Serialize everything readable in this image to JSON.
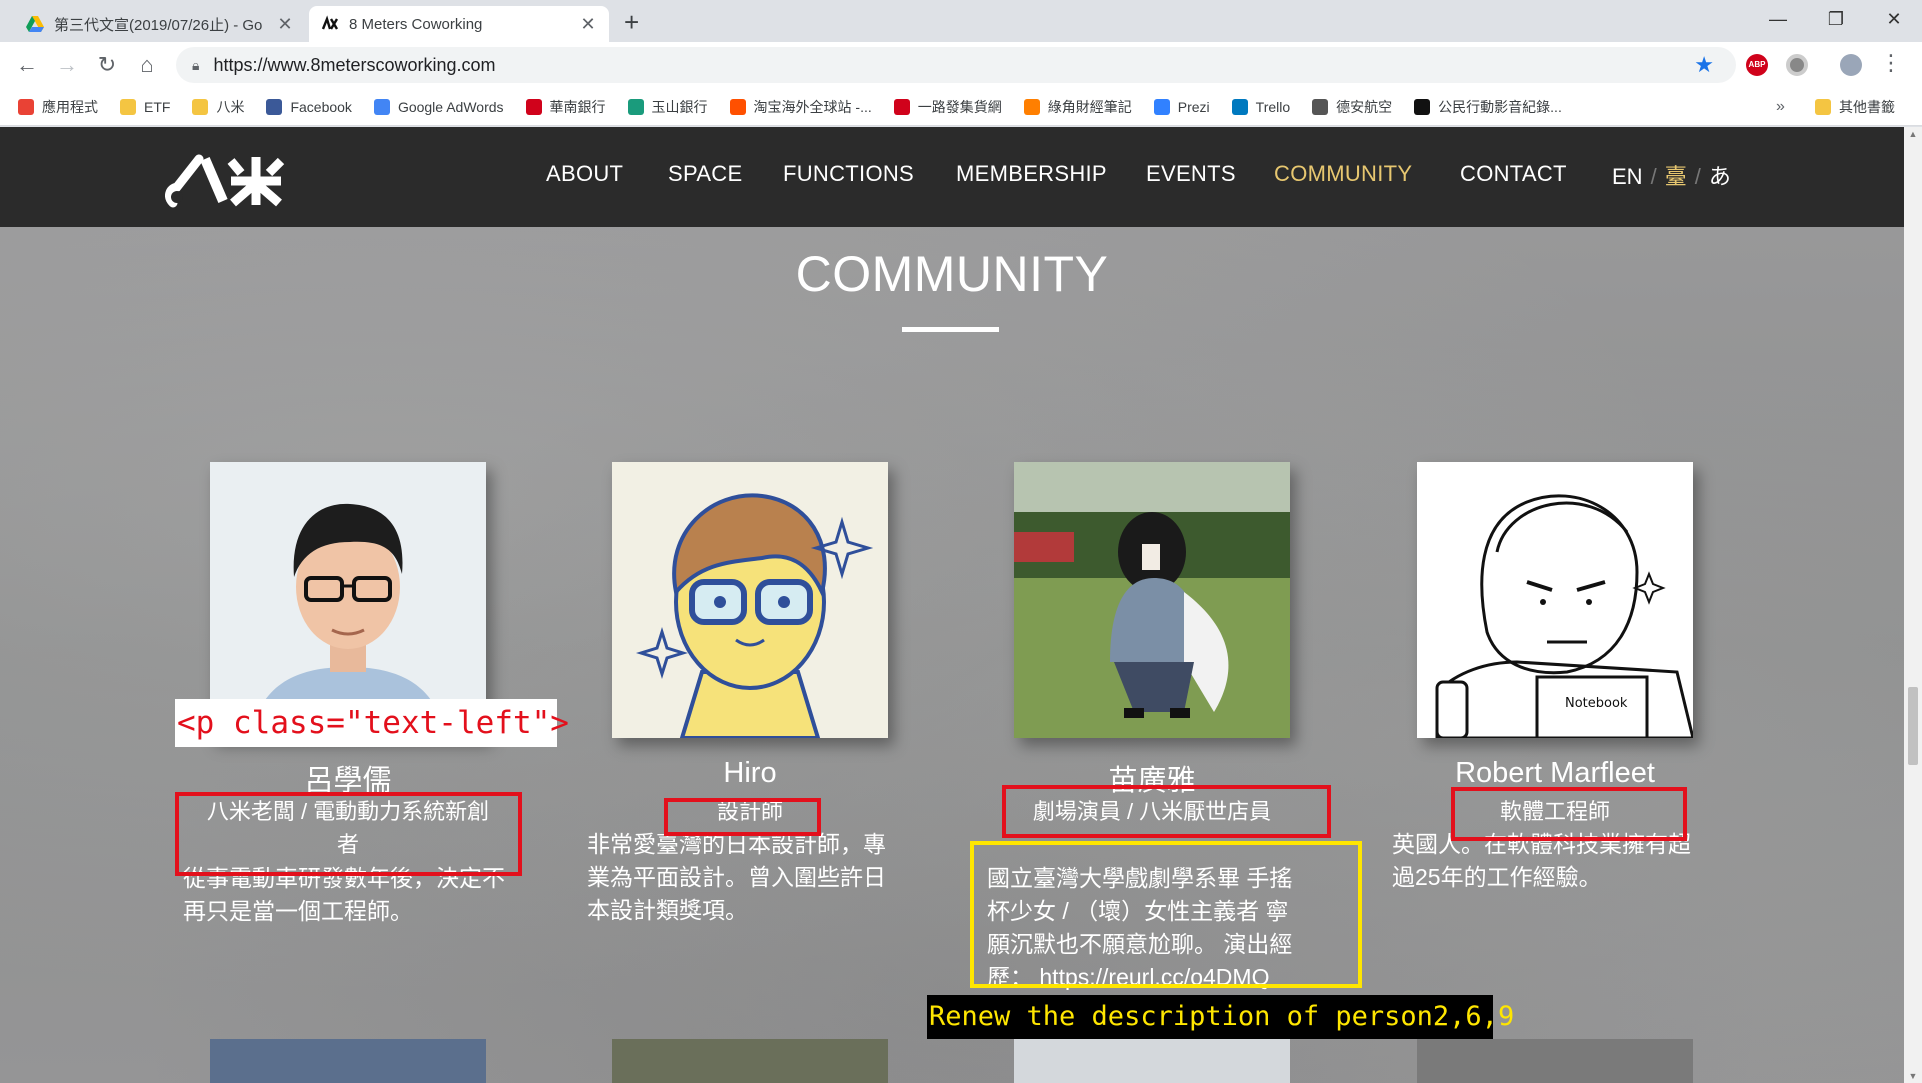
{
  "browser": {
    "tabs": [
      {
        "title": "第三代文宣(2019/07/26止) - Go",
        "active": false
      },
      {
        "title": "8 Meters Coworking",
        "active": true
      }
    ],
    "new_tab": "+",
    "window_controls": {
      "minimize": "—",
      "maximize": "❐",
      "close": "✕"
    },
    "url": "https://www.8meterscoworking.com",
    "extensions": {
      "abp": "ABP"
    },
    "bookmarks": [
      {
        "label": "應用程式",
        "icon": "apps-grid-icon",
        "color": "#e94235"
      },
      {
        "label": "ETF",
        "icon": "folder-icon",
        "color": "#f4c542"
      },
      {
        "label": "八米",
        "icon": "folder-icon",
        "color": "#f4c542"
      },
      {
        "label": "Facebook",
        "icon": "facebook-icon",
        "color": "#3b5998"
      },
      {
        "label": "Google AdWords",
        "icon": "adwords-icon",
        "color": "#4285f4"
      },
      {
        "label": "華南銀行",
        "icon": "bank-icon",
        "color": "#d0021b"
      },
      {
        "label": "玉山銀行",
        "icon": "bank-icon",
        "color": "#1a9b7c"
      },
      {
        "label": "淘宝海外全球站 -...",
        "icon": "taobao-icon",
        "color": "#ff5000"
      },
      {
        "label": "一路發集貨網",
        "icon": "shipping-icon",
        "color": "#d0021b"
      },
      {
        "label": "綠角財經筆記",
        "icon": "blogger-icon",
        "color": "#ff7f00"
      },
      {
        "label": "Prezi",
        "icon": "prezi-icon",
        "color": "#3181ff"
      },
      {
        "label": "Trello",
        "icon": "trello-icon",
        "color": "#0079bf"
      },
      {
        "label": "德安航空",
        "icon": "globe-icon",
        "color": "#555555"
      },
      {
        "label": "公民行動影音紀錄...",
        "icon": "civil-icon",
        "color": "#111111"
      }
    ],
    "bookmarks_more": "»",
    "other_bookmarks": "其他書籤"
  },
  "site": {
    "nav": [
      "ABOUT",
      "SPACE",
      "FUNCTIONS",
      "MEMBERSHIP",
      "EVENTS",
      "COMMUNITY",
      "CONTACT"
    ],
    "active_nav": "COMMUNITY",
    "active_color": "#e7c770",
    "languages": [
      "EN",
      "臺",
      "あ"
    ],
    "language_sep": "/",
    "section_title": "COMMUNITY"
  },
  "members": [
    {
      "name": "呂學儒",
      "role": "八米老闆 / 電動動力系統新創者",
      "description": "從事電動車研發數年後，決定不再只是當一個工程師。"
    },
    {
      "name": "Hiro",
      "role": "設計師",
      "description": "非常愛臺灣的日本設計師，專業為平面設計。曾入圍些許日本設計類獎項。"
    },
    {
      "name": "苗廣雅",
      "role": "劇場演員 / 八米厭世店員",
      "description": "國立臺灣大學戲劇學系畢 手搖杯少女 / （壞）女性主義者 寧願沉默也不願意尬聊。 演出經歷： https://reurl.cc/o4DMQ"
    },
    {
      "name": "Robert Marfleet",
      "role": "軟體工程師",
      "description": "英國人。在軟體科技業擁有超過25年的工作經驗。"
    }
  ],
  "annotations": {
    "code_label": "<p class=\"text-left\">",
    "note": "Renew the description of person2,6,9",
    "red_color": "#e3101c",
    "yellow_color": "#ffe600"
  }
}
